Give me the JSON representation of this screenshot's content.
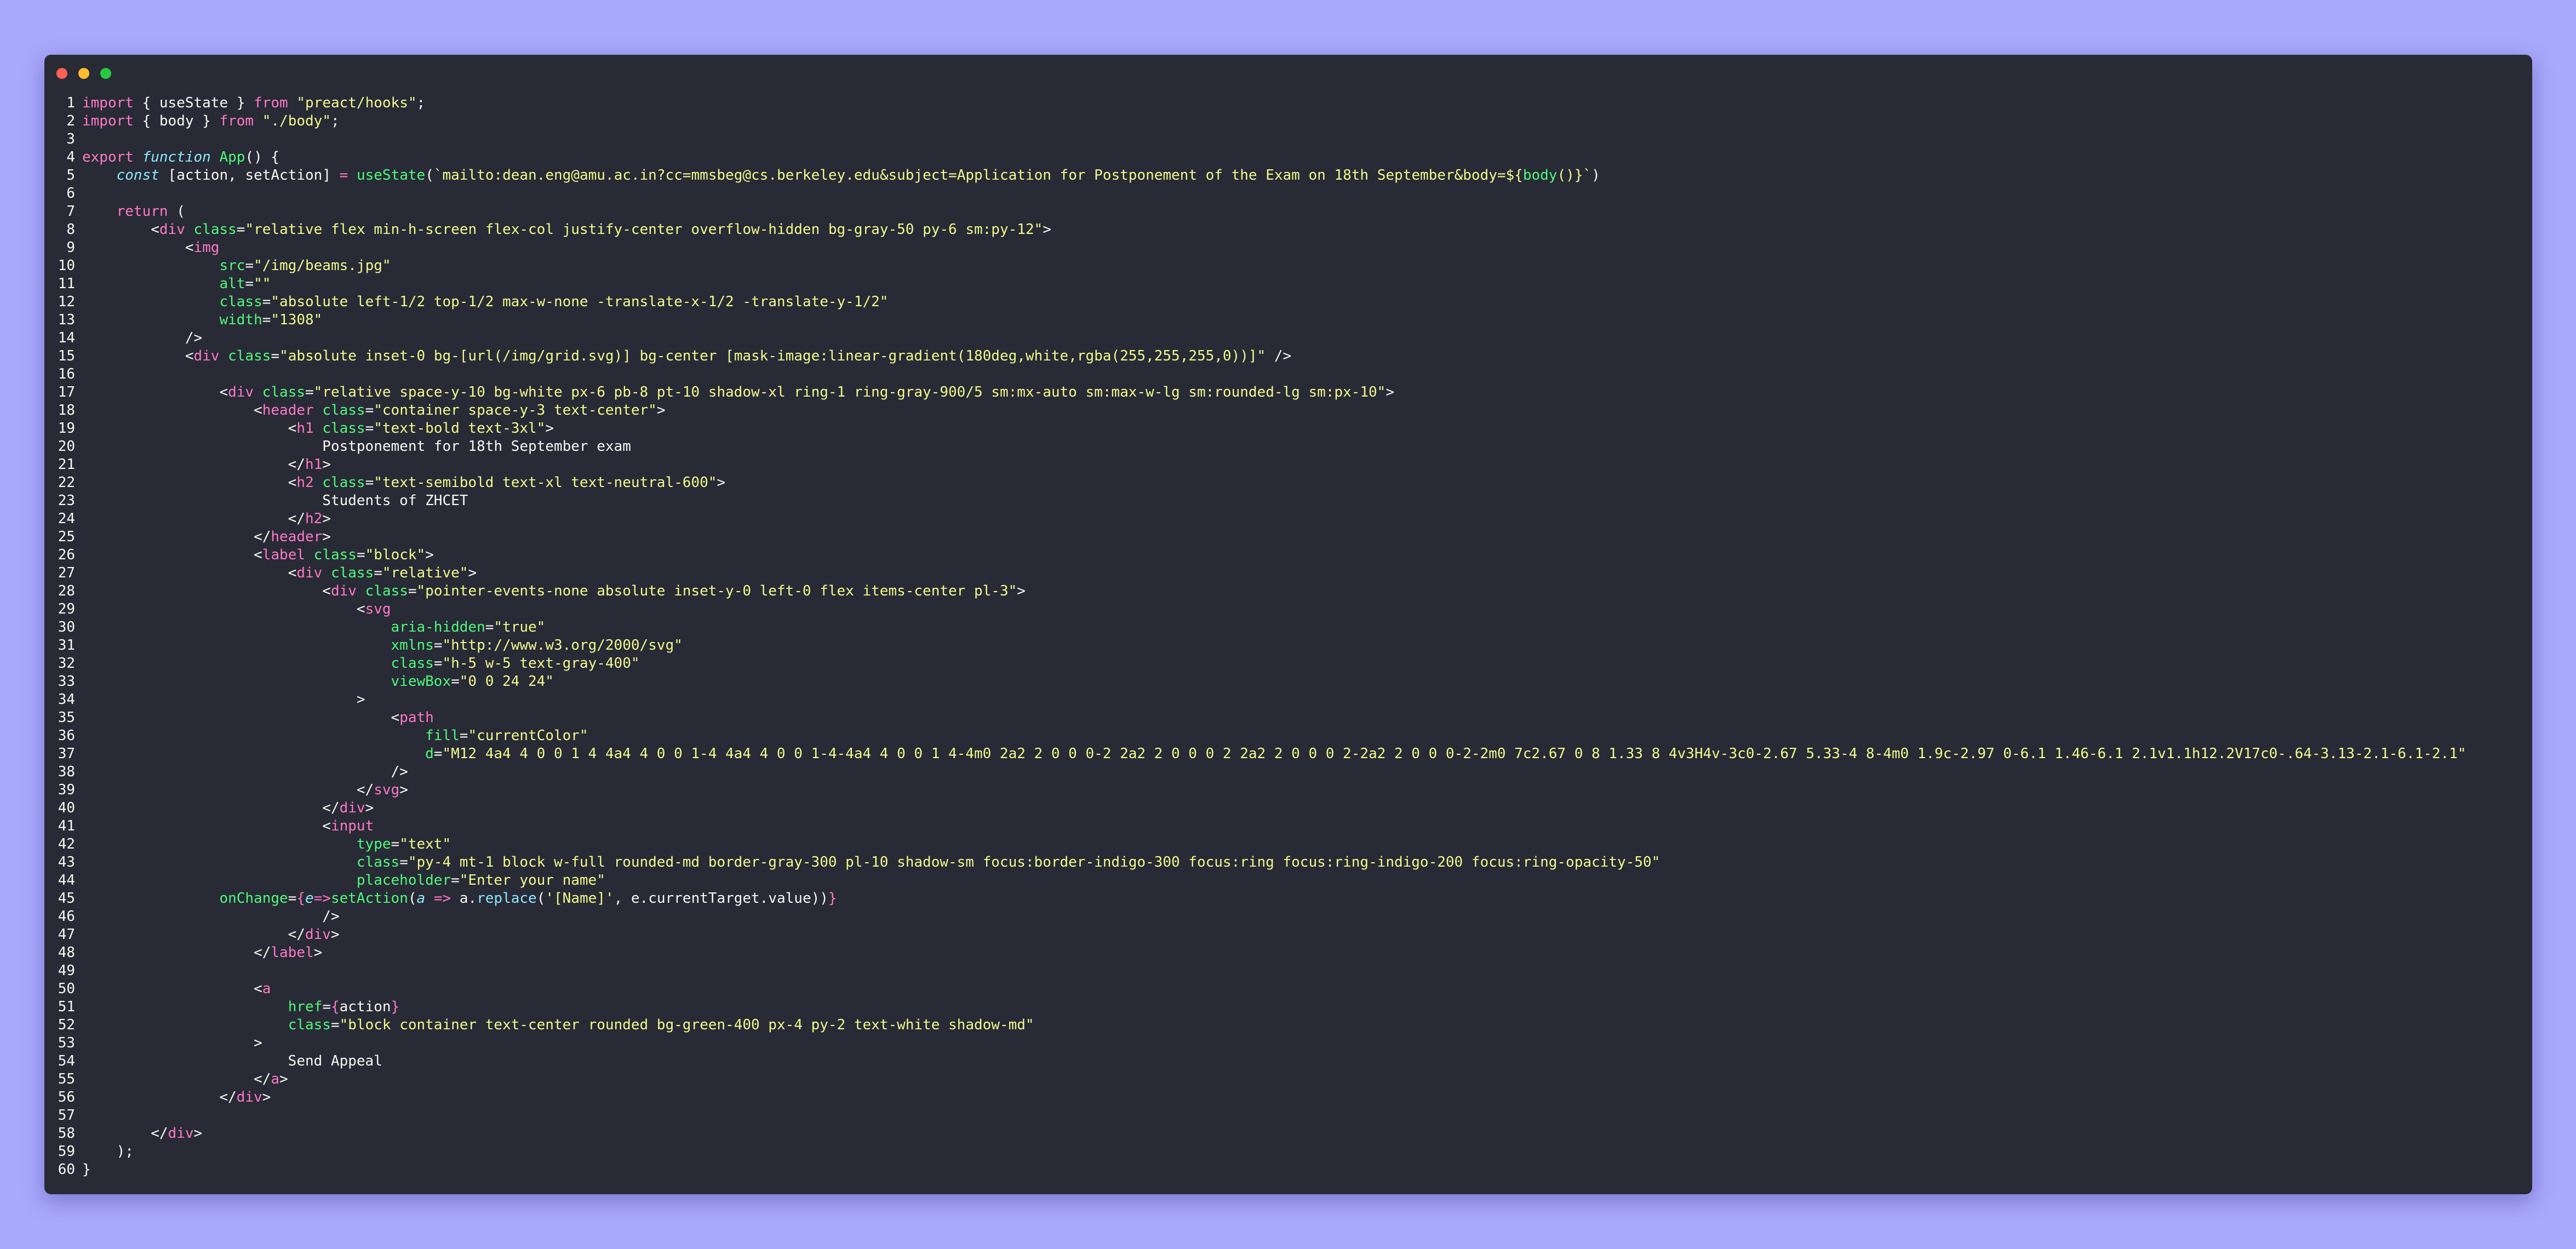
{
  "window": {
    "colors": {
      "background": "#282a36",
      "keyword": "#ff79c6",
      "string": "#f1fa8c",
      "attribute": "#50fa7b",
      "function": "#50fa7b",
      "builtin": "#8be9fd",
      "text": "#f8f8f2",
      "page": "#a8a8fc"
    },
    "controls": [
      "close-dot",
      "minimize-dot",
      "maximize-dot"
    ]
  },
  "code": {
    "lines": [
      {
        "n": "1",
        "t": [
          [
            "import",
            "k"
          ],
          [
            " { useState } ",
            "pu"
          ],
          [
            "from",
            "k"
          ],
          [
            " \"preact/hooks\"",
            "s"
          ],
          [
            ";",
            "pu"
          ]
        ]
      },
      {
        "n": "2",
        "t": [
          [
            "import",
            "k"
          ],
          [
            " { body } ",
            "pu"
          ],
          [
            "from",
            "k"
          ],
          [
            " \"./body\"",
            "s"
          ],
          [
            ";",
            "pu"
          ]
        ]
      },
      {
        "n": "3",
        "t": []
      },
      {
        "n": "4",
        "t": [
          [
            "export",
            "k"
          ],
          [
            " ",
            "pu"
          ],
          [
            "function",
            "i"
          ],
          [
            " ",
            "pu"
          ],
          [
            "App",
            "f"
          ],
          [
            "() {",
            "pu"
          ]
        ]
      },
      {
        "n": "5",
        "t": [
          [
            "    ",
            "pu"
          ],
          [
            "const",
            "i"
          ],
          [
            " [action, setAction] ",
            "pu"
          ],
          [
            "=",
            "k"
          ],
          [
            " ",
            "pu"
          ],
          [
            "useState",
            "f"
          ],
          [
            "(",
            "pu"
          ],
          [
            "`mailto:dean.eng@amu.ac.in?cc=mmsbeg@cs.berkeley.edu&subject=Application for Postponement of the Exam on 18th September&body=${",
            "s"
          ],
          [
            "body",
            "f"
          ],
          [
            "()}`",
            "s"
          ],
          [
            ")",
            "pu"
          ]
        ]
      },
      {
        "n": "6",
        "t": []
      },
      {
        "n": "7",
        "t": [
          [
            "    ",
            "pu"
          ],
          [
            "return",
            "k"
          ],
          [
            " (",
            "pu"
          ]
        ]
      },
      {
        "n": "8",
        "t": [
          [
            "        <",
            "pu"
          ],
          [
            "div",
            "k"
          ],
          [
            " ",
            "pu"
          ],
          [
            "class",
            "a"
          ],
          [
            "=",
            "pu"
          ],
          [
            "\"relative flex min-h-screen flex-col justify-center overflow-hidden bg-gray-50 py-6 sm:py-12\"",
            "s"
          ],
          [
            ">",
            "pu"
          ]
        ]
      },
      {
        "n": "9",
        "t": [
          [
            "            <",
            "pu"
          ],
          [
            "img",
            "k"
          ]
        ]
      },
      {
        "n": "10",
        "t": [
          [
            "                ",
            "pu"
          ],
          [
            "src",
            "a"
          ],
          [
            "=",
            "pu"
          ],
          [
            "\"/img/beams.jpg\"",
            "s"
          ]
        ]
      },
      {
        "n": "11",
        "t": [
          [
            "                ",
            "pu"
          ],
          [
            "alt",
            "a"
          ],
          [
            "=",
            "pu"
          ],
          [
            "\"\"",
            "s"
          ]
        ]
      },
      {
        "n": "12",
        "t": [
          [
            "                ",
            "pu"
          ],
          [
            "class",
            "a"
          ],
          [
            "=",
            "pu"
          ],
          [
            "\"absolute left-1/2 top-1/2 max-w-none -translate-x-1/2 -translate-y-1/2\"",
            "s"
          ]
        ]
      },
      {
        "n": "13",
        "t": [
          [
            "                ",
            "pu"
          ],
          [
            "width",
            "a"
          ],
          [
            "=",
            "pu"
          ],
          [
            "\"1308\"",
            "s"
          ]
        ]
      },
      {
        "n": "14",
        "t": [
          [
            "            />",
            "pu"
          ]
        ]
      },
      {
        "n": "15",
        "t": [
          [
            "            <",
            "pu"
          ],
          [
            "div",
            "k"
          ],
          [
            " ",
            "pu"
          ],
          [
            "class",
            "a"
          ],
          [
            "=",
            "pu"
          ],
          [
            "\"absolute inset-0 bg-[url(/img/grid.svg)] bg-center [mask-image:linear-gradient(180deg,white,rgba(255,255,255,0))]\"",
            "s"
          ],
          [
            " />",
            "pu"
          ]
        ]
      },
      {
        "n": "16",
        "t": []
      },
      {
        "n": "17",
        "t": [
          [
            "                <",
            "pu"
          ],
          [
            "div",
            "k"
          ],
          [
            " ",
            "pu"
          ],
          [
            "class",
            "a"
          ],
          [
            "=",
            "pu"
          ],
          [
            "\"relative space-y-10 bg-white px-6 pb-8 pt-10 shadow-xl ring-1 ring-gray-900/5 sm:mx-auto sm:max-w-lg sm:rounded-lg sm:px-10\"",
            "s"
          ],
          [
            ">",
            "pu"
          ]
        ]
      },
      {
        "n": "18",
        "t": [
          [
            "                    <",
            "pu"
          ],
          [
            "header",
            "k"
          ],
          [
            " ",
            "pu"
          ],
          [
            "class",
            "a"
          ],
          [
            "=",
            "pu"
          ],
          [
            "\"container space-y-3 text-center\"",
            "s"
          ],
          [
            ">",
            "pu"
          ]
        ]
      },
      {
        "n": "19",
        "t": [
          [
            "                        <",
            "pu"
          ],
          [
            "h1",
            "k"
          ],
          [
            " ",
            "pu"
          ],
          [
            "class",
            "a"
          ],
          [
            "=",
            "pu"
          ],
          [
            "\"text-bold text-3xl\"",
            "s"
          ],
          [
            ">",
            "pu"
          ]
        ]
      },
      {
        "n": "20",
        "t": [
          [
            "                            Postponement for 18th September exam",
            "pu"
          ]
        ]
      },
      {
        "n": "21",
        "t": [
          [
            "                        </",
            "pu"
          ],
          [
            "h1",
            "k"
          ],
          [
            ">",
            "pu"
          ]
        ]
      },
      {
        "n": "22",
        "t": [
          [
            "                        <",
            "pu"
          ],
          [
            "h2",
            "k"
          ],
          [
            " ",
            "pu"
          ],
          [
            "class",
            "a"
          ],
          [
            "=",
            "pu"
          ],
          [
            "\"text-semibold text-xl text-neutral-600\"",
            "s"
          ],
          [
            ">",
            "pu"
          ]
        ]
      },
      {
        "n": "23",
        "t": [
          [
            "                            Students of ZHCET",
            "pu"
          ]
        ]
      },
      {
        "n": "24",
        "t": [
          [
            "                        </",
            "pu"
          ],
          [
            "h2",
            "k"
          ],
          [
            ">",
            "pu"
          ]
        ]
      },
      {
        "n": "25",
        "t": [
          [
            "                    </",
            "pu"
          ],
          [
            "header",
            "k"
          ],
          [
            ">",
            "pu"
          ]
        ]
      },
      {
        "n": "26",
        "t": [
          [
            "                    <",
            "pu"
          ],
          [
            "label",
            "k"
          ],
          [
            " ",
            "pu"
          ],
          [
            "class",
            "a"
          ],
          [
            "=",
            "pu"
          ],
          [
            "\"block\"",
            "s"
          ],
          [
            ">",
            "pu"
          ]
        ]
      },
      {
        "n": "27",
        "t": [
          [
            "                        <",
            "pu"
          ],
          [
            "div",
            "k"
          ],
          [
            " ",
            "pu"
          ],
          [
            "class",
            "a"
          ],
          [
            "=",
            "pu"
          ],
          [
            "\"relative\"",
            "s"
          ],
          [
            ">",
            "pu"
          ]
        ]
      },
      {
        "n": "28",
        "t": [
          [
            "                            <",
            "pu"
          ],
          [
            "div",
            "k"
          ],
          [
            " ",
            "pu"
          ],
          [
            "class",
            "a"
          ],
          [
            "=",
            "pu"
          ],
          [
            "\"pointer-events-none absolute inset-y-0 left-0 flex items-center pl-3\"",
            "s"
          ],
          [
            ">",
            "pu"
          ]
        ]
      },
      {
        "n": "29",
        "t": [
          [
            "                                <",
            "pu"
          ],
          [
            "svg",
            "k"
          ]
        ]
      },
      {
        "n": "30",
        "t": [
          [
            "                                    ",
            "pu"
          ],
          [
            "aria-hidden",
            "a"
          ],
          [
            "=",
            "pu"
          ],
          [
            "\"true\"",
            "s"
          ]
        ]
      },
      {
        "n": "31",
        "t": [
          [
            "                                    ",
            "pu"
          ],
          [
            "xmlns",
            "a"
          ],
          [
            "=",
            "pu"
          ],
          [
            "\"http://www.w3.org/2000/svg\"",
            "s"
          ]
        ]
      },
      {
        "n": "32",
        "t": [
          [
            "                                    ",
            "pu"
          ],
          [
            "class",
            "a"
          ],
          [
            "=",
            "pu"
          ],
          [
            "\"h-5 w-5 text-gray-400\"",
            "s"
          ]
        ]
      },
      {
        "n": "33",
        "t": [
          [
            "                                    ",
            "pu"
          ],
          [
            "viewBox",
            "a"
          ],
          [
            "=",
            "pu"
          ],
          [
            "\"0 0 24 24\"",
            "s"
          ]
        ]
      },
      {
        "n": "34",
        "t": [
          [
            "                                >",
            "pu"
          ]
        ]
      },
      {
        "n": "35",
        "t": [
          [
            "                                    <",
            "pu"
          ],
          [
            "path",
            "k"
          ]
        ]
      },
      {
        "n": "36",
        "t": [
          [
            "                                        ",
            "pu"
          ],
          [
            "fill",
            "a"
          ],
          [
            "=",
            "pu"
          ],
          [
            "\"currentColor\"",
            "s"
          ]
        ]
      },
      {
        "n": "37",
        "t": [
          [
            "                                        ",
            "pu"
          ],
          [
            "d",
            "a"
          ],
          [
            "=",
            "pu"
          ],
          [
            "\"M12 4a4 4 0 0 1 4 4a4 4 0 0 1-4 4a4 4 0 0 1-4-4a4 4 0 0 1 4-4m0 2a2 2 0 0 0-2 2a2 2 0 0 0 2 2a2 2 0 0 0 2-2a2 2 0 0 0-2-2m0 7c2.67 0 8 1.33 8 4v3H4v-3c0-2.67 5.33-4 8-4m0 1.9c-2.97 0-6.1 1.46-6.1 2.1v1.1h12.2V17c0-.64-3.13-2.1-6.1-2.1\"",
            "s"
          ]
        ]
      },
      {
        "n": "38",
        "t": [
          [
            "                                    />",
            "pu"
          ]
        ]
      },
      {
        "n": "39",
        "t": [
          [
            "                                </",
            "pu"
          ],
          [
            "svg",
            "k"
          ],
          [
            ">",
            "pu"
          ]
        ]
      },
      {
        "n": "40",
        "t": [
          [
            "                            </",
            "pu"
          ],
          [
            "div",
            "k"
          ],
          [
            ">",
            "pu"
          ]
        ]
      },
      {
        "n": "41",
        "t": [
          [
            "                            <",
            "pu"
          ],
          [
            "input",
            "k"
          ]
        ]
      },
      {
        "n": "42",
        "t": [
          [
            "                                ",
            "pu"
          ],
          [
            "type",
            "a"
          ],
          [
            "=",
            "pu"
          ],
          [
            "\"text\"",
            "s"
          ]
        ]
      },
      {
        "n": "43",
        "t": [
          [
            "                                ",
            "pu"
          ],
          [
            "class",
            "a"
          ],
          [
            "=",
            "pu"
          ],
          [
            "\"py-4 mt-1 block w-full rounded-md border-gray-300 pl-10 shadow-sm focus:border-indigo-300 focus:ring focus:ring-indigo-200 focus:ring-opacity-50\"",
            "s"
          ]
        ]
      },
      {
        "n": "44",
        "t": [
          [
            "                                ",
            "pu"
          ],
          [
            "placeholder",
            "a"
          ],
          [
            "=",
            "pu"
          ],
          [
            "\"Enter your name\"",
            "s"
          ]
        ]
      },
      {
        "n": "45",
        "t": [
          [
            "                ",
            "pu"
          ],
          [
            "onChange",
            "a"
          ],
          [
            "=",
            "pu"
          ],
          [
            "{",
            "k"
          ],
          [
            "e",
            "i"
          ],
          [
            "=>",
            "k"
          ],
          [
            "setAction",
            "f"
          ],
          [
            "(",
            "pu"
          ],
          [
            "a",
            "i"
          ],
          [
            " ",
            "pu"
          ],
          [
            "=>",
            "k"
          ],
          [
            " a.",
            "pu"
          ],
          [
            "replace",
            "n"
          ],
          [
            "(",
            "pu"
          ],
          [
            "'[Name]'",
            "s"
          ],
          [
            ", e.currentTarget.value))",
            "pu"
          ],
          [
            "}",
            "k"
          ]
        ]
      },
      {
        "n": "46",
        "t": [
          [
            "                            />",
            "pu"
          ]
        ]
      },
      {
        "n": "47",
        "t": [
          [
            "                        </",
            "pu"
          ],
          [
            "div",
            "k"
          ],
          [
            ">",
            "pu"
          ]
        ]
      },
      {
        "n": "48",
        "t": [
          [
            "                    </",
            "pu"
          ],
          [
            "label",
            "k"
          ],
          [
            ">",
            "pu"
          ]
        ]
      },
      {
        "n": "49",
        "t": []
      },
      {
        "n": "50",
        "t": [
          [
            "                    <",
            "pu"
          ],
          [
            "a",
            "k"
          ]
        ]
      },
      {
        "n": "51",
        "t": [
          [
            "                        ",
            "pu"
          ],
          [
            "href",
            "a"
          ],
          [
            "=",
            "pu"
          ],
          [
            "{",
            "k"
          ],
          [
            "action",
            "pu"
          ],
          [
            "}",
            "k"
          ]
        ]
      },
      {
        "n": "52",
        "t": [
          [
            "                        ",
            "pu"
          ],
          [
            "class",
            "a"
          ],
          [
            "=",
            "pu"
          ],
          [
            "\"block container text-center rounded bg-green-400 px-4 py-2 text-white shadow-md\"",
            "s"
          ]
        ]
      },
      {
        "n": "53",
        "t": [
          [
            "                    >",
            "pu"
          ]
        ]
      },
      {
        "n": "54",
        "t": [
          [
            "                        Send Appeal",
            "pu"
          ]
        ]
      },
      {
        "n": "55",
        "t": [
          [
            "                    </",
            "pu"
          ],
          [
            "a",
            "k"
          ],
          [
            ">",
            "pu"
          ]
        ]
      },
      {
        "n": "56",
        "t": [
          [
            "                </",
            "pu"
          ],
          [
            "div",
            "k"
          ],
          [
            ">",
            "pu"
          ]
        ]
      },
      {
        "n": "57",
        "t": []
      },
      {
        "n": "58",
        "t": [
          [
            "        </",
            "pu"
          ],
          [
            "div",
            "k"
          ],
          [
            ">",
            "pu"
          ]
        ]
      },
      {
        "n": "59",
        "t": [
          [
            "    );",
            "pu"
          ]
        ]
      },
      {
        "n": "60",
        "t": [
          [
            "}",
            "pu"
          ]
        ]
      }
    ]
  }
}
